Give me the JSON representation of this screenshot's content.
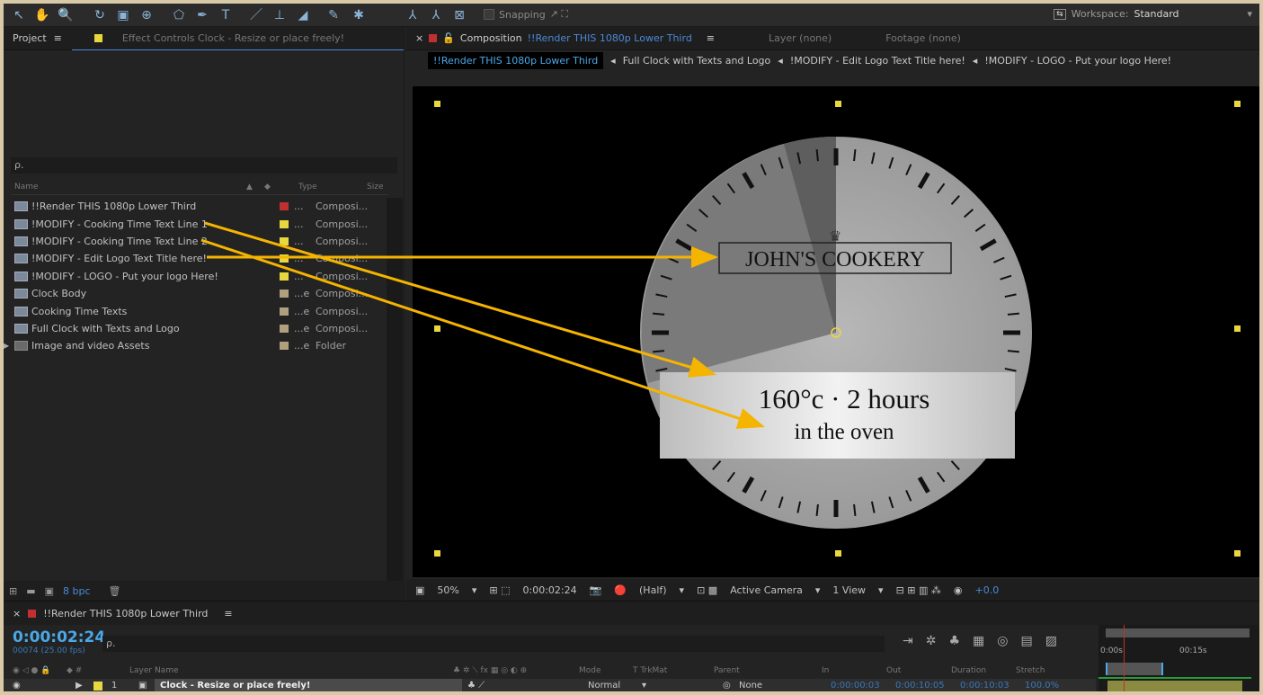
{
  "toolbar": {
    "snapping_label": "Snapping",
    "workspace_label": "Workspace:",
    "workspace_value": "Standard"
  },
  "project": {
    "tab_label": "Project",
    "effect_tab_label": "Effect Controls  Clock - Resize or place freely!",
    "search_icon": "ρ.",
    "columns": {
      "name": "Name",
      "type": "Type",
      "size": "Size"
    },
    "items": [
      {
        "name": "!!Render THIS 1080p Lower Third",
        "label_color": "#c03030",
        "dots": "...",
        "type": "Composi..."
      },
      {
        "name": "!MODIFY - Cooking Time Text Line 1",
        "label_color": "#e8d840",
        "dots": "...",
        "type": "Composi..."
      },
      {
        "name": "!MODIFY - Cooking Time Text Line 2",
        "label_color": "#e8d840",
        "dots": "...",
        "type": "Composi..."
      },
      {
        "name": "!MODIFY - Edit Logo Text Title here!",
        "label_color": "#e8d840",
        "dots": "...",
        "type": "Composi..."
      },
      {
        "name": "!MODIFY - LOGO - Put your logo Here!",
        "label_color": "#e8d840",
        "dots": "...",
        "type": "Composi..."
      },
      {
        "name": "Clock Body",
        "label_color": "#b0a080",
        "dots": "...e",
        "type": "Composi..."
      },
      {
        "name": "Cooking Time Texts",
        "label_color": "#b0a080",
        "dots": "...e",
        "type": "Composi..."
      },
      {
        "name": "Full Clock with Texts and Logo",
        "label_color": "#b0a080",
        "dots": "...e",
        "type": "Composi..."
      },
      {
        "name": "Image and video Assets",
        "label_color": "#b0a080",
        "dots": "...e",
        "type": "Folder"
      }
    ],
    "bpc": "8 bpc"
  },
  "composition": {
    "tab_prefix": "Composition",
    "tab_name": "!!Render THIS 1080p Lower Third",
    "layer_tab": "Layer  (none)",
    "footage_tab": "Footage  (none)",
    "breadcrumbs": [
      "!!Render THIS 1080p Lower Third",
      "Full Clock with Texts and Logo",
      "!MODIFY - Edit Logo Text Title here!",
      "!MODIFY - LOGO - Put your logo Here!"
    ],
    "logo_text": "JOHN'S COOKERY",
    "cook_line1": "160°c · 2 hours",
    "cook_line2": "in the oven",
    "zoom": "50%",
    "time": "0:00:02:24",
    "resolution": "(Half)",
    "camera": "Active Camera",
    "views": "1 View",
    "exposure": "+0.0"
  },
  "timeline": {
    "tab_name": "!!Render THIS 1080p Lower Third",
    "timecode": "0:00:02:24",
    "fps": "00074 (25.00 fps)",
    "search_icon": "ρ.",
    "columns": {
      "layer_name": "Layer Name",
      "mode": "Mode",
      "trkmat": "T  TrkMat",
      "parent": "Parent",
      "in": "In",
      "out": "Out",
      "duration": "Duration",
      "stretch": "Stretch"
    },
    "layer": {
      "index": "1",
      "name": "Clock - Resize or place freely!",
      "mode": "Normal",
      "parent": "None",
      "in": "0:00:00:03",
      "out": "0:00:10:05",
      "duration": "0:00:10:03",
      "stretch": "100.0%"
    },
    "ruler": {
      "start": "0:00s",
      "mark": "00:15s"
    }
  },
  "colors": {
    "accent_blue": "#4aa8e8",
    "label_yellow": "#e8d840",
    "label_red": "#c03030",
    "arrow": "#f5b400"
  }
}
